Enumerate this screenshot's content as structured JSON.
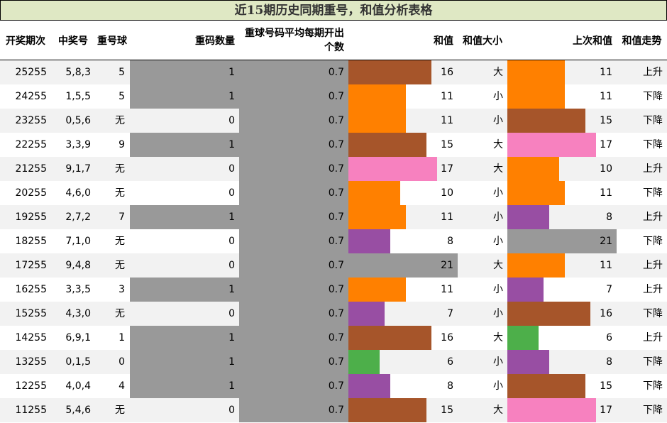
{
  "title": "近15期历史同期重号，和值分析表格",
  "headers": {
    "period": "开奖期次",
    "number": "中奖号",
    "repeat_ball": "重号球",
    "repeat_count": "重码数量",
    "avg_repeat": "重球号码平均每期开出个数",
    "sum": "和值",
    "sum_size": "和值大小",
    "prev_sum": "上次和值",
    "sum_trend": "和值走势"
  },
  "colors": {
    "gray_bar": "#999999",
    "orange": "#ff8000",
    "brown": "#a6552a",
    "pink": "#f781bf",
    "purple": "#984ea3",
    "green": "#4daf4a",
    "title_bg": "#dfe8c4",
    "row_alt": "#f2f2f2"
  },
  "chart_data": {
    "type": "table",
    "title": "近15期历史同期重号，和值分析表格",
    "columns": [
      "开奖期次",
      "中奖号",
      "重号球",
      "重码数量",
      "重球号码平均每期开出个数",
      "和值",
      "和值大小",
      "上次和值",
      "和值走势"
    ],
    "bar_columns": {
      "repeat_count_max": 1,
      "avg_repeat_max": 0.7,
      "sum_max": 21
    },
    "rows": [
      {
        "period": "25255",
        "number": "5,8,3",
        "repeat_ball": "5",
        "repeat_count": 1,
        "avg_repeat": 0.7,
        "sum": 16,
        "sum_size": "大",
        "prev_sum": 11,
        "sum_trend": "上升"
      },
      {
        "period": "24255",
        "number": "1,5,5",
        "repeat_ball": "5",
        "repeat_count": 1,
        "avg_repeat": 0.7,
        "sum": 11,
        "sum_size": "小",
        "prev_sum": 11,
        "sum_trend": "下降"
      },
      {
        "period": "23255",
        "number": "0,5,6",
        "repeat_ball": "无",
        "repeat_count": 0,
        "avg_repeat": 0.7,
        "sum": 11,
        "sum_size": "小",
        "prev_sum": 15,
        "sum_trend": "下降"
      },
      {
        "period": "22255",
        "number": "3,3,9",
        "repeat_ball": "9",
        "repeat_count": 1,
        "avg_repeat": 0.7,
        "sum": 15,
        "sum_size": "大",
        "prev_sum": 17,
        "sum_trend": "下降"
      },
      {
        "period": "21255",
        "number": "9,1,7",
        "repeat_ball": "无",
        "repeat_count": 0,
        "avg_repeat": 0.7,
        "sum": 17,
        "sum_size": "大",
        "prev_sum": 10,
        "sum_trend": "上升"
      },
      {
        "period": "20255",
        "number": "4,6,0",
        "repeat_ball": "无",
        "repeat_count": 0,
        "avg_repeat": 0.7,
        "sum": 10,
        "sum_size": "小",
        "prev_sum": 11,
        "sum_trend": "下降"
      },
      {
        "period": "19255",
        "number": "2,7,2",
        "repeat_ball": "7",
        "repeat_count": 1,
        "avg_repeat": 0.7,
        "sum": 11,
        "sum_size": "小",
        "prev_sum": 8,
        "sum_trend": "上升"
      },
      {
        "period": "18255",
        "number": "7,1,0",
        "repeat_ball": "无",
        "repeat_count": 0,
        "avg_repeat": 0.7,
        "sum": 8,
        "sum_size": "小",
        "prev_sum": 21,
        "sum_trend": "下降"
      },
      {
        "period": "17255",
        "number": "9,4,8",
        "repeat_ball": "无",
        "repeat_count": 0,
        "avg_repeat": 0.7,
        "sum": 21,
        "sum_size": "大",
        "prev_sum": 11,
        "sum_trend": "上升"
      },
      {
        "period": "16255",
        "number": "3,3,5",
        "repeat_ball": "3",
        "repeat_count": 1,
        "avg_repeat": 0.7,
        "sum": 11,
        "sum_size": "小",
        "prev_sum": 7,
        "sum_trend": "上升"
      },
      {
        "period": "15255",
        "number": "4,3,0",
        "repeat_ball": "无",
        "repeat_count": 0,
        "avg_repeat": 0.7,
        "sum": 7,
        "sum_size": "小",
        "prev_sum": 16,
        "sum_trend": "下降"
      },
      {
        "period": "14255",
        "number": "6,9,1",
        "repeat_ball": "1",
        "repeat_count": 1,
        "avg_repeat": 0.7,
        "sum": 16,
        "sum_size": "大",
        "prev_sum": 6,
        "sum_trend": "上升"
      },
      {
        "period": "13255",
        "number": "0,1,5",
        "repeat_ball": "0",
        "repeat_count": 1,
        "avg_repeat": 0.7,
        "sum": 6,
        "sum_size": "小",
        "prev_sum": 8,
        "sum_trend": "下降"
      },
      {
        "period": "12255",
        "number": "4,0,4",
        "repeat_ball": "4",
        "repeat_count": 1,
        "avg_repeat": 0.7,
        "sum": 8,
        "sum_size": "小",
        "prev_sum": 15,
        "sum_trend": "下降"
      },
      {
        "period": "11255",
        "number": "5,4,6",
        "repeat_ball": "无",
        "repeat_count": 0,
        "avg_repeat": 0.7,
        "sum": 15,
        "sum_size": "大",
        "prev_sum": 17,
        "sum_trend": "下降"
      }
    ]
  }
}
